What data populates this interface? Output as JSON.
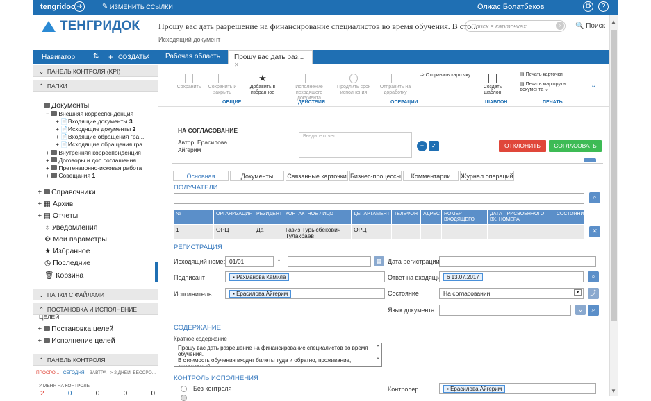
{
  "topbar": {
    "brand": "tengridoc",
    "edit_links": "ИЗМЕНИТЬ ССЫЛКИ",
    "user": "Олжас Болатбеков"
  },
  "header": {
    "logo": "ТЕНГРИДОК",
    "doc_title": "Прошу вас дать разрешение на финансирование специалистов во время обучения. В сто...",
    "doc_subtitle": "Исходящий документ",
    "search_placeholder": "Поиск в карточках",
    "search_link": "Поиск"
  },
  "sidebar": {
    "nav_title": "Навигатор",
    "create": "СОЗДАТЬ",
    "kpi": "ПАНЕЛЬ КОНТРОЛЯ (KPI)",
    "folders": "ПАПКИ",
    "tree": {
      "documents": "Документы",
      "external": "Внешняя корреспонденция",
      "incoming": "Входящие документы",
      "incoming_count": "3",
      "outgoing": "Исходящие документы",
      "outgoing_count": "2",
      "incoming_appeals": "Входящие обращения гра...",
      "outgoing_appeals": "Исходящие обращения гра...",
      "internal": "Внутренняя корреспонденция",
      "contracts": "Договоры и доп.соглашения",
      "claims": "Претензионно-исковая работа",
      "meetings": "Совещания",
      "meetings_count": "1",
      "references": "Справочники",
      "archive": "Архив",
      "reports": "Отчеты",
      "notifications": "Уведомления",
      "my_params": "Мои параметры",
      "favorites": "Избранное",
      "recent": "Последние",
      "trash": "Корзина"
    },
    "file_folders": "ПАПКИ С ФАЙЛАМИ",
    "goals": "ПОСТАНОВКА И ИСПОЛНЕНИЕ ЦЕЛЕЙ",
    "goal_set": "Постановка целей",
    "goal_exec": "Исполнение целей",
    "panel": "ПАНЕЛЬ КОНТРОЛЯ",
    "panel_tabs": [
      "ПРОСРО...",
      "СЕГОДНЯ",
      "ЗАВТРА",
      "> 2 ДНЕЙ",
      "БЕССРО..."
    ],
    "panel_sub": "У МЕНЯ НА КОНТРОЛЕ",
    "panel_counts": [
      "2",
      "0",
      "0",
      "0",
      "0"
    ]
  },
  "tabs": {
    "workspace": "Рабочая область",
    "doc_tab": "Прошу вас дать раз..."
  },
  "ribbon": {
    "save": "Сохранить",
    "save_close": "Сохранить и закрыть",
    "add_fav": "Добавить в избранное",
    "exec_doc": "Исполнение исходящего документа",
    "extend": "Продлить срок исполнения",
    "send_card": "Отправить на доработку",
    "send_card_top": "Отправить карточку",
    "create_template": "Создать шаблон",
    "print_card": "Печать карточки",
    "print_route": "Печать маршрута документа",
    "g_common": "ОБЩИЕ",
    "g_actions": "ДЕЙСТВИЯ",
    "g_ops": "ОПЕРАЦИИ",
    "g_template": "ШАБЛОН",
    "g_print": "ПЕЧАТЬ"
  },
  "approval": {
    "title": "НА СОГЛАСОВАНИЕ",
    "author_label": "Автор:",
    "author": "Ерасилова",
    "author2": "Айгерим",
    "report_placeholder": "Введите отчет",
    "reject": "ОТКЛОНИТЬ",
    "approve": "СОГЛАСОВАТЬ"
  },
  "doc_tabs": [
    "Основная",
    "Документы",
    "Связанные карточки",
    "Бизнес-процессы",
    "Комментарии",
    "Журнал операций"
  ],
  "recipients": {
    "title": "ПОЛУЧАТЕЛИ",
    "columns": [
      "№",
      "ОРГАНИЗАЦИЯ",
      "РЕЗИДЕНТ",
      "КОНТАКТНОЕ ЛИЦО",
      "ДЕПАРТАМЕНТ",
      "ТЕЛЕФОН",
      "АДРЕС",
      "НОМЕР ВХОДЯЩЕГО",
      "ДАТА ПРИСВОЕННОГО ВХ. НОМЕРА",
      "СОСТОЯНИЕ"
    ],
    "row": [
      "1",
      "ОРЦ",
      "Да",
      "Газиз Турысбекович Тулакбаев",
      "ОРЦ",
      "",
      "",
      "",
      "",
      ""
    ]
  },
  "registration": {
    "title": "РЕГИСТРАЦИЯ",
    "out_number_label": "Исходящий номер",
    "out_number": "01/01",
    "reg_date_label": "Дата регистрации",
    "signer_label": "Подписант",
    "signer": "Рахманова Камила",
    "reply_label": "Ответ на входящий",
    "reply": "6 13.07.2017",
    "executor_label": "Исполнитель",
    "executor": "Ерасилова Айгерим",
    "state_label": "Состояние",
    "state": "На согласовании",
    "lang_label": "Язык документа"
  },
  "content": {
    "title": "СОДЕРЖАНИЕ",
    "summary_label": "Краткое содержание",
    "summary_line1": "Прошу вас дать разрешение на финансирование специалистов во время",
    "summary_line2": "обучения.",
    "summary_line3": "В стоимость обучения входят билеты туда и обратно, проживание, ежедневный"
  },
  "control": {
    "title": "КОНТРОЛЬ ИСПОЛНЕНИЯ",
    "no_control": "Без контроля",
    "controller_label": "Контролер",
    "controller": "Ерасилова Айгерим"
  },
  "colors": {
    "primary": "#1f6fb3",
    "table_header": "#5b8fc9",
    "reject": "#e0473a",
    "approve": "#3dbb55"
  }
}
